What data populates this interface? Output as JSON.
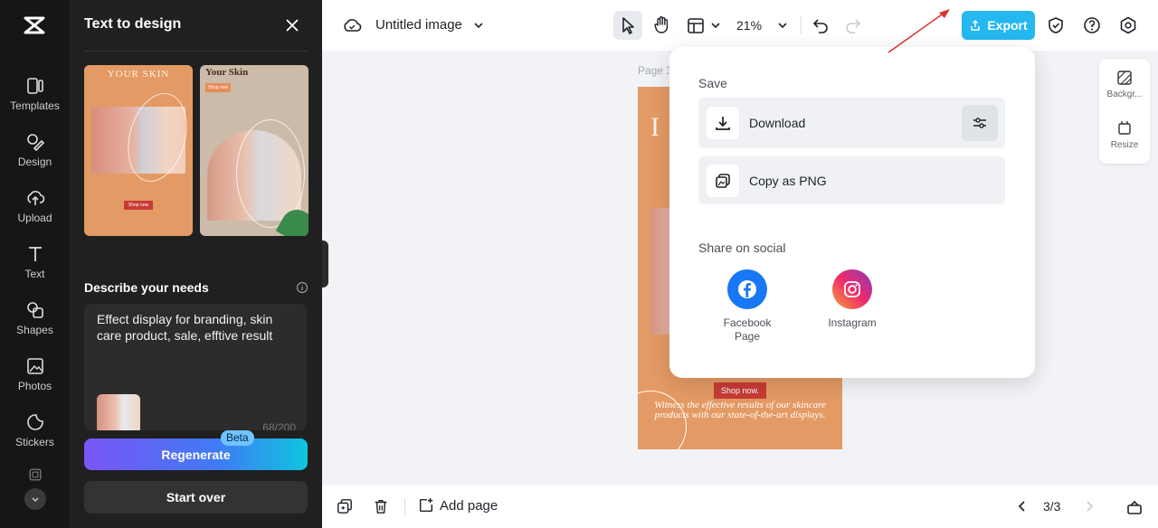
{
  "rail": {
    "items": [
      {
        "label": "Templates",
        "icon": "templates-icon"
      },
      {
        "label": "Design",
        "icon": "design-icon"
      },
      {
        "label": "Upload",
        "icon": "upload-icon"
      },
      {
        "label": "Text",
        "icon": "text-icon"
      },
      {
        "label": "Shapes",
        "icon": "shapes-icon"
      },
      {
        "label": "Photos",
        "icon": "photos-icon"
      },
      {
        "label": "Stickers",
        "icon": "stickers-icon"
      }
    ]
  },
  "panel": {
    "title": "Text to design",
    "thumb1_title": "YOUR SKIN",
    "thumb1_shop": "Shop now",
    "thumb2_title": "Your Skin",
    "thumb2_shop": "Shop now",
    "needs_label": "Describe your needs",
    "needs_text": "Effect display for branding, skin care product, sale, efftive result",
    "needs_count": "68/200",
    "regenerate": "Regenerate",
    "beta": "Beta",
    "start_over": "Start over"
  },
  "topbar": {
    "title": "Untitled image",
    "zoom": "21%",
    "export": "Export"
  },
  "canvas": {
    "page_label": "Page 3",
    "shop_now": "Shop now.",
    "caption": "Witness the effective results of our skincare products with our state-of-the-art displays."
  },
  "right_tools": {
    "background": "Backgr...",
    "resize": "Resize"
  },
  "export_menu": {
    "save_heading": "Save",
    "download": "Download",
    "copy_png": "Copy as PNG",
    "share_heading": "Share on social",
    "facebook": "Facebook Page",
    "instagram": "Instagram"
  },
  "bottombar": {
    "add_page": "Add page",
    "page_indicator": "3/3"
  },
  "colors": {
    "accent": "#25b7f0",
    "panel_bg": "#202020",
    "facebook": "#1877f2",
    "annotation_arrow": "#e0312b"
  }
}
